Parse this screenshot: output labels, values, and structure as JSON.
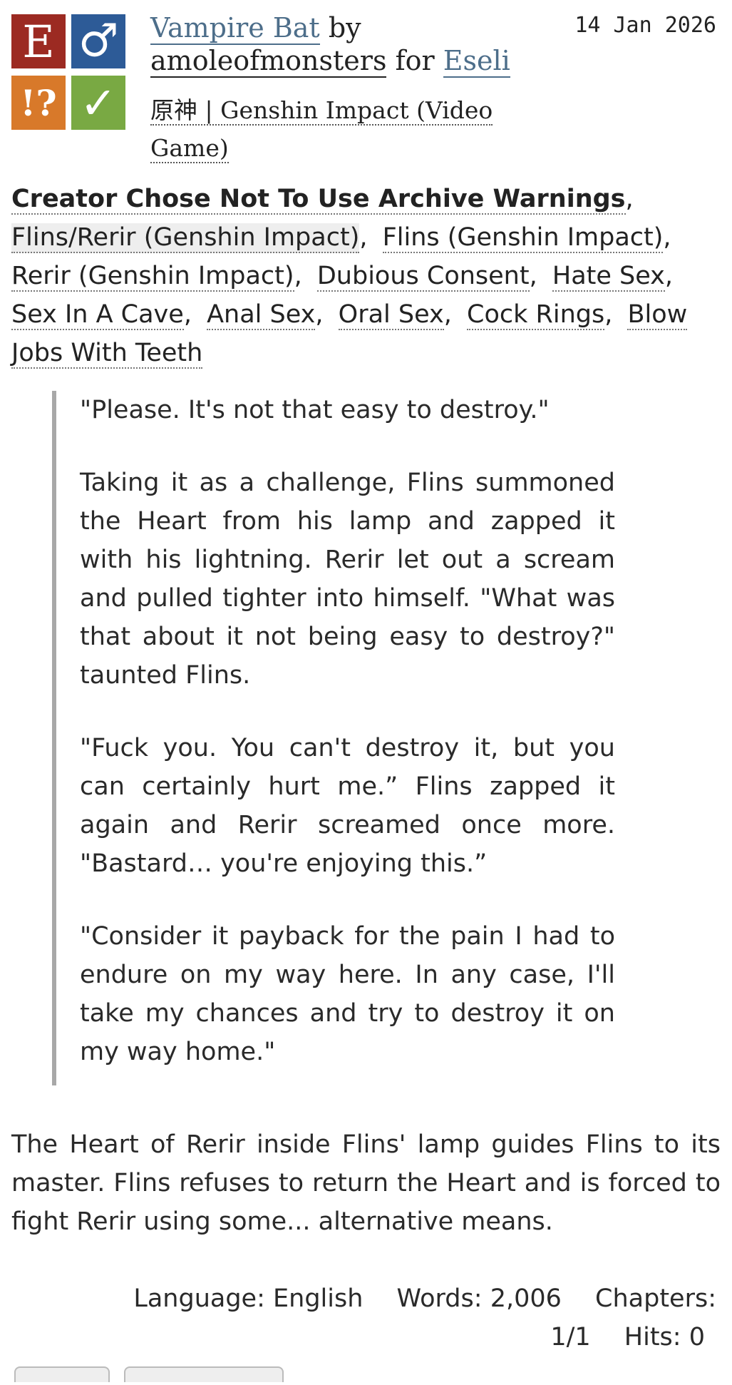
{
  "work": {
    "title": "Vampire Bat",
    "by_word": "by",
    "author": "amoleofmonsters",
    "for_word": "for",
    "recipient": "Eseli",
    "fandom": "原神 | Genshin Impact (Video Game)",
    "date": "14 Jan 2026"
  },
  "symbols": {
    "rating": "E",
    "category": "♂",
    "warning": "!?",
    "complete": "✓",
    "colors": {
      "rating": "#9c2a22",
      "category": "#2d5b97",
      "warning": "#d8792a",
      "complete": "#79a943"
    }
  },
  "tags": {
    "warning": "Creator Chose Not To Use Archive Warnings",
    "relationship": "Flins/Rerir (Genshin Impact)",
    "characters": [
      "Flins (Genshin Impact)",
      "Rerir (Genshin Impact)"
    ],
    "freeforms": [
      "Dubious Consent",
      "Hate Sex",
      "Sex In A Cave",
      "Anal Sex",
      "Oral Sex",
      "Cock Rings",
      "Blow Jobs With Teeth"
    ]
  },
  "quote": [
    "\"Please. It's not that easy to destroy.\"",
    "Taking it as a challenge, Flins summoned the Heart from his lamp and zapped it with his lightning. Rerir let out a scream and pulled tighter into himself. \"What was that about it not being easy to destroy?\" taunted Flins.",
    "\"Fuck you. You can't destroy it, but you can certainly hurt me.” Flins zapped it again and Rerir screamed once more. \"Bastard… you're enjoying this.”",
    "\"Consider it payback for the pain I had to endure on my way here. In any case, I'll take my chances and try to destroy it on my way home.\""
  ],
  "summary": "The Heart of Rerir inside Flins' lamp guides Flins to its master. Flins refuses to return the Heart and is forced to fight Rerir using some... alternative means.",
  "stats": {
    "language_label": "Language:",
    "language": "English",
    "words_label": "Words:",
    "words": "2,006",
    "chapters_label": "Chapters:",
    "chapters": "1/1",
    "hits_label": "Hits:",
    "hits": "0"
  }
}
